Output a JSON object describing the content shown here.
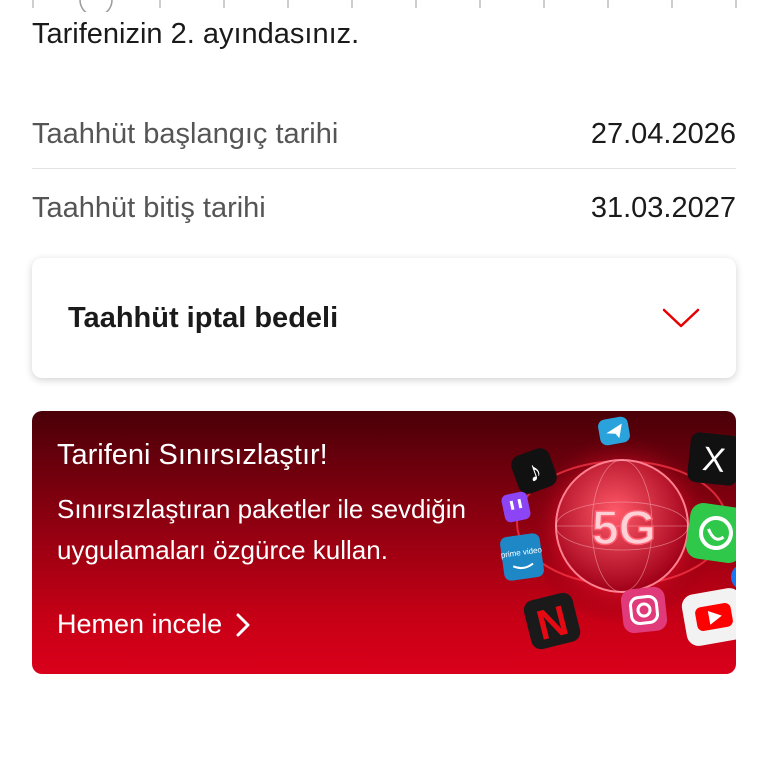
{
  "tariff_status": "Tarifenizin 2. ayındasınız.",
  "commitment": {
    "start_label": "Taahhüt başlangıç tarihi",
    "start_value": "27.04.2026",
    "end_label": "Taahhüt bitiş tarihi",
    "end_value": "31.03.2027"
  },
  "cancellation": {
    "title": "Taahhüt iptal bedeli",
    "icon": "chevron-down-icon",
    "accent": "#e60000"
  },
  "promo": {
    "title": "Tarifeni Sınırsızlaştır!",
    "description": "Sınırsızlaştıran paketler ile sevdiğin uygulamaları özgürce kullan.",
    "cta": "Hemen incele",
    "badge": "5G",
    "apps": [
      "tiktok-icon",
      "telegram-icon",
      "x-icon",
      "twitch-icon",
      "prime-video-icon",
      "whatsapp-icon",
      "messenger-icon",
      "netflix-icon",
      "instagram-icon",
      "youtube-icon"
    ],
    "prime_text": "prime video",
    "x_text": "X"
  }
}
